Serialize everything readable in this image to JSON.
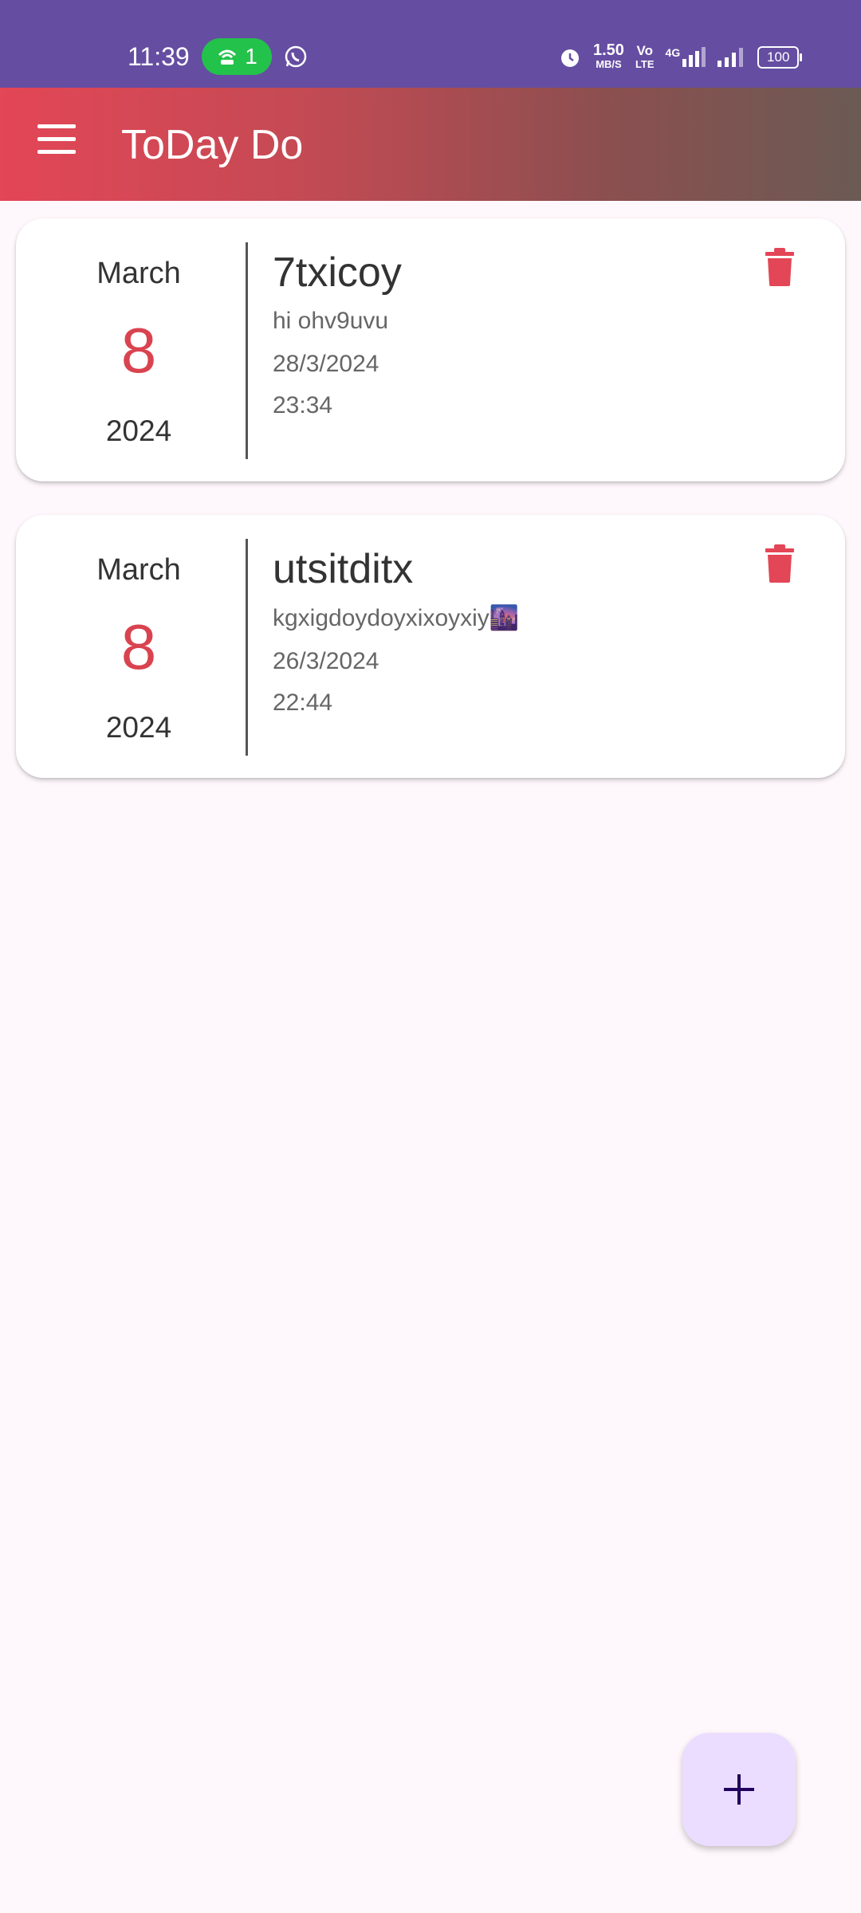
{
  "status_bar": {
    "time": "11:39",
    "hotspot_count": "1",
    "speed": "1.50",
    "speed_unit": "MB/S",
    "volte_top": "Vo",
    "volte_bottom": "LTE",
    "network": "4G",
    "battery": "100"
  },
  "app_bar": {
    "title": "ToDay Do",
    "menu_icon": "hamburger-menu-icon",
    "gradient_start": "#e34656",
    "gradient_end": "#6b5a54"
  },
  "tasks": [
    {
      "month": "March",
      "day": "8",
      "year": "2024",
      "title": "7txicoy",
      "description": "hi ohv9uvu",
      "due_date": "28/3/2024",
      "due_time": "23:34",
      "delete_icon": "trash-icon"
    },
    {
      "month": "March",
      "day": "8",
      "year": "2024",
      "title": "utsitditx",
      "description": "kgxigdoydoyxixoyxiy🌆",
      "due_date": "26/3/2024",
      "due_time": "22:44",
      "delete_icon": "trash-icon"
    }
  ],
  "fab": {
    "icon": "plus-icon"
  },
  "colors": {
    "status_bar": "#654da2",
    "accent_red": "#d9434f",
    "fab_bg": "#eaddff",
    "background": "#fef7fb"
  }
}
